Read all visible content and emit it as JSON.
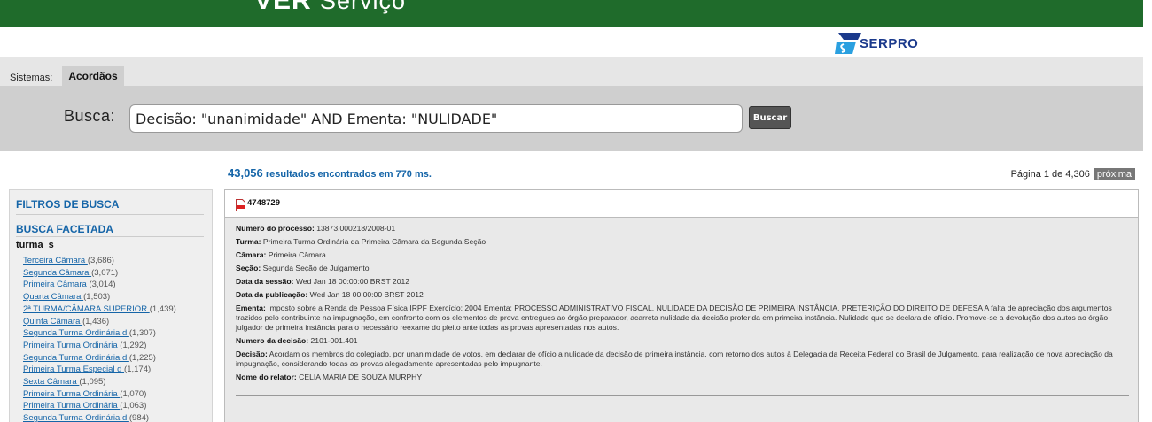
{
  "header": {
    "brand_bold": "VER",
    "brand_rest": "Serviço",
    "serpro_logo": "SERPRO"
  },
  "systems": {
    "label": "Sistemas:",
    "active_tab": "Acordãos"
  },
  "search": {
    "label": "Busca:",
    "query": "Decisão: \"unanimidade\" AND Ementa: \"NULIDADE\"",
    "button": "Buscar"
  },
  "results": {
    "count": "43,056",
    "suffix": "resultados encontrados em 770 ms."
  },
  "pager": {
    "text": "Página 1 de 4,306",
    "next": "próxima"
  },
  "sidebar": {
    "filters_title": "FILTROS DE BUSCA",
    "faceted_title": "BUSCA FACETADA",
    "field": "turma_s",
    "facets": [
      {
        "label": "Terceira Câmara ",
        "count": "(3,686)"
      },
      {
        "label": "Segunda Câmara ",
        "count": "(3,071)"
      },
      {
        "label": "Primeira Câmara ",
        "count": "(3,014)"
      },
      {
        "label": "Quarta Câmara ",
        "count": "(1,503)"
      },
      {
        "label": "2ª TURMA/CÂMARA SUPERIOR ",
        "count": "(1,439)"
      },
      {
        "label": "Quinta Câmara ",
        "count": "(1,436)"
      },
      {
        "label": "Segunda Turma Ordinária d ",
        "count": "(1,307)"
      },
      {
        "label": "Primeira Turma Ordinária ",
        "count": "(1,292)"
      },
      {
        "label": "Segunda Turma Ordinária d ",
        "count": "(1,225)"
      },
      {
        "label": "Primeira Turma Especial d ",
        "count": "(1,174)"
      },
      {
        "label": "Sexta Câmara ",
        "count": "(1,095)"
      },
      {
        "label": "Primeira Turma Ordinária ",
        "count": "(1,070)"
      },
      {
        "label": "Primeira Turma Ordinária ",
        "count": "(1,063)"
      },
      {
        "label": "Segunda Turma Ordinária d ",
        "count": "(984)"
      }
    ]
  },
  "result": {
    "id": "4748729",
    "fields": {
      "numero_processo": {
        "label": "Numero do processo:",
        "value": " 13873.000218/2008-01"
      },
      "turma": {
        "label": "Turma:",
        "value": " Primeira Turma Ordinária da Primeira Câmara da Segunda Seção"
      },
      "camara": {
        "label": "Câmara:",
        "value": " Primeira Câmara"
      },
      "secao": {
        "label": "Seção:",
        "value": " Segunda Seção de Julgamento"
      },
      "data_sessao": {
        "label": "Data da sessão:",
        "value": " Wed Jan 18 00:00:00 BRST 2012"
      },
      "data_publicacao": {
        "label": "Data da publicação:",
        "value": " Wed Jan 18 00:00:00 BRST 2012"
      },
      "ementa": {
        "label": "Ementa:",
        "value": " Imposto sobre a Renda de Pessoa Física IRPF Exercício: 2004 Ementa: PROCESSO ADMINISTRATIVO FISCAL. NULIDADE DA DECISÃO DE PRIMEIRA INSTÂNCIA. PRETERIÇÃO DO DIREITO DE DEFESA A falta de apreciação dos argumentos trazidos pelo contribuinte na impugnação, em confronto com os elementos de prova entregues ao órgão preparador, acarreta nulidade da decisão proferida em primeira instância. Nulidade que se declara de ofício. Promove-se a devolução dos autos ao órgão julgador de primeira instância para o necessário reexame do pleito ante todas as provas apresentadas nos autos."
      },
      "numero_decisao": {
        "label": "Numero da decisão:",
        "value": " 2101-001.401"
      },
      "decisao": {
        "label": "Decisão:",
        "value": " Acordam os membros do colegiado, por unanimidade de votos, em declarar de ofício a nulidade da decisão de primeira instância, com retorno dos autos à Delegacia da Receita Federal do Brasil de Julgamento, para realização de nova apreciação da impugnação, considerando todas as provas alegadamente apresentadas pelo impugnante."
      },
      "relator": {
        "label": "Nome do relator:",
        "value": " CELIA MARIA DE SOUZA MURPHY"
      }
    }
  }
}
